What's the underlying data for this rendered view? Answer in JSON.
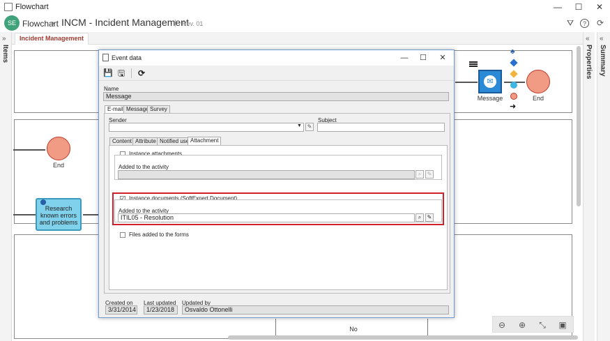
{
  "window": {
    "title": "Flowchart",
    "controls": {
      "minimize": "—",
      "maximize": "☐",
      "close": "✕"
    }
  },
  "header": {
    "logo_text": "SE",
    "breadcrumb": "Flowchart",
    "separator": "›",
    "title": "INCM - Incident Management",
    "pipe": "|",
    "revision": "Rev. 01",
    "icons": {
      "save": "⛛",
      "help": "?",
      "refresh": "⟳"
    }
  },
  "left_panel": {
    "label": "Items",
    "chevron": "»"
  },
  "right_panels": [
    {
      "label": "Properties",
      "chevron": "«"
    },
    {
      "label": "Summary",
      "chevron": "«"
    }
  ],
  "tabs": [
    {
      "label": "Incident Management"
    }
  ],
  "canvas": {
    "end_label_top": "End",
    "end_label_left": "End",
    "message_label": "Message",
    "task_label": "Research known errors and problems",
    "no_label": "No"
  },
  "dialog": {
    "title": "Event data",
    "controls": {
      "minimize": "—",
      "maximize": "☐",
      "close": "✕"
    },
    "toolbar": {
      "save": "💾",
      "save_close": "🖫",
      "refresh": "⟳"
    },
    "name_label": "Name",
    "name_value": "Message",
    "tabs": [
      {
        "label": "E-mail"
      },
      {
        "label": "Message"
      },
      {
        "label": "Survey"
      }
    ],
    "sender_label": "Sender",
    "sender_value": "",
    "subject_label": "Subject",
    "subject_value": "",
    "sub_tabs": [
      {
        "label": "Content"
      },
      {
        "label": "Attribute"
      },
      {
        "label": "Notified user"
      },
      {
        "label": "Attachment"
      }
    ],
    "instance_attachments": {
      "label": "Instance attachments",
      "checked": false,
      "added_label": "Added to the activity",
      "added_value": ""
    },
    "instance_documents": {
      "label": "Instance documents (SoftExpert Document)",
      "checked": true,
      "added_label": "Added to the activity",
      "added_value": "ITIL05 - Resolution"
    },
    "files_added": {
      "label": "Files added to the forms",
      "checked": false
    },
    "footer": {
      "created_label": "Created on",
      "created_value": "3/31/2014",
      "updated_label": "Last updated",
      "updated_value": "1/23/2018",
      "updated_by_label": "Updated by",
      "updated_by_value": "Osvaldo Ottonelli"
    }
  },
  "zoom": {
    "zoom_out": "⊖",
    "zoom_in": "⊕",
    "fit": "⤡",
    "image": "▣"
  },
  "colors": {
    "accent_red": "#d0202a",
    "task_fill": "#7fd1ec",
    "end_fill": "#f19a84",
    "message_fill": "#2a8ad6"
  }
}
